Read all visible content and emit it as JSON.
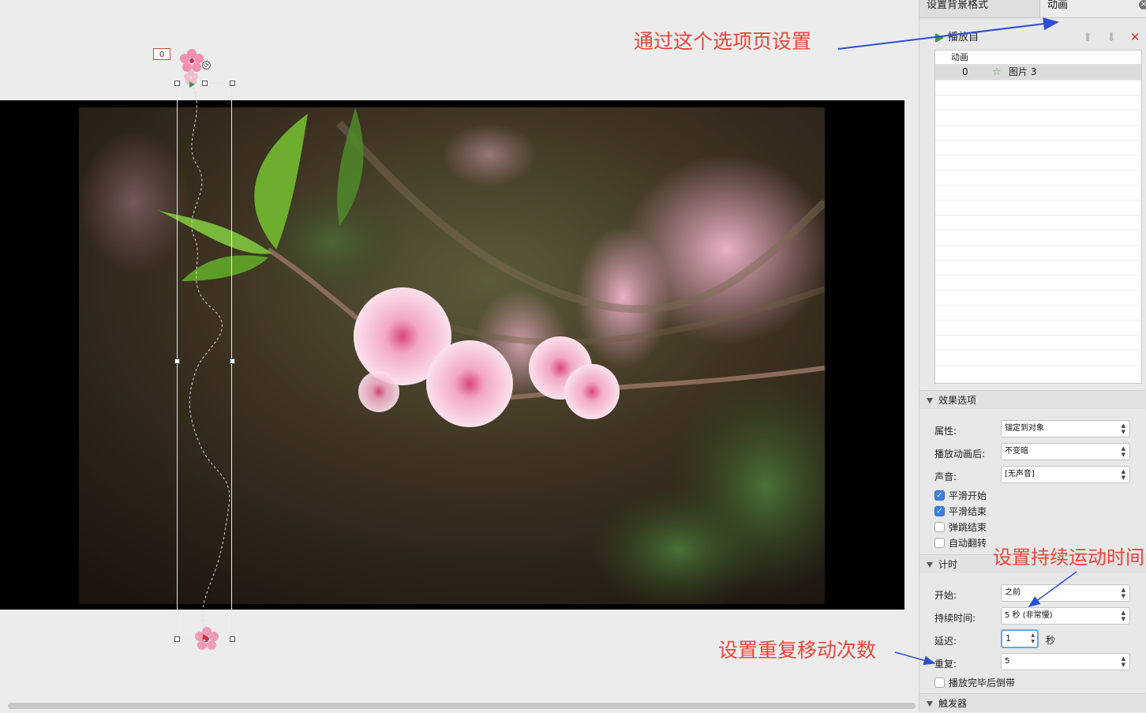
{
  "stage": {
    "animation_badge": "0",
    "annotations": {
      "tab_hint": "通过这个选项页设置",
      "duration_hint": "设置持续运动时间",
      "repeat_hint": "设置重复移动次数"
    }
  },
  "panel": {
    "tabs": [
      {
        "label": "设置背景格式"
      },
      {
        "label": "动画"
      }
    ],
    "close_icon": "close-circle-icon",
    "toolbar": {
      "play_label": "播放自",
      "icons": [
        "move-up-icon",
        "move-down-icon",
        "delete-icon"
      ]
    },
    "anim_list": {
      "header": "动画",
      "rows": [
        {
          "order": "0",
          "icon": "motion-path-star-icon",
          "name": "图片 3"
        }
      ]
    },
    "effect_options": {
      "title": "效果选项",
      "fields": [
        {
          "label": "属性:",
          "value": "锚定到对象"
        },
        {
          "label": "播放动画后:",
          "value": "不变暗"
        },
        {
          "label": "声音:",
          "value": "[无声音]"
        }
      ],
      "checkboxes": [
        {
          "label": "平滑开始",
          "checked": true
        },
        {
          "label": "平滑结束",
          "checked": true
        },
        {
          "label": "弹跳结束",
          "checked": false
        },
        {
          "label": "自动翻转",
          "checked": false
        }
      ]
    },
    "timing": {
      "title": "计时",
      "start_label": "开始:",
      "start_value": "之前",
      "duration_label": "持续时间:",
      "duration_value": "5 秒 (非常慢)",
      "delay_label": "延迟:",
      "delay_value": "1",
      "delay_unit": "秒",
      "repeat_label": "重复:",
      "repeat_value": "5",
      "rewind_label": "播放完毕后倒带",
      "rewind_checked": false
    },
    "trigger": {
      "title": "触发器"
    }
  },
  "colors": {
    "annotation": "#e8463a",
    "arrow": "#2a4fd6",
    "accent_check": "#3b82e0",
    "play_green": "#3a9a3a",
    "delete_red": "#d9342b"
  }
}
